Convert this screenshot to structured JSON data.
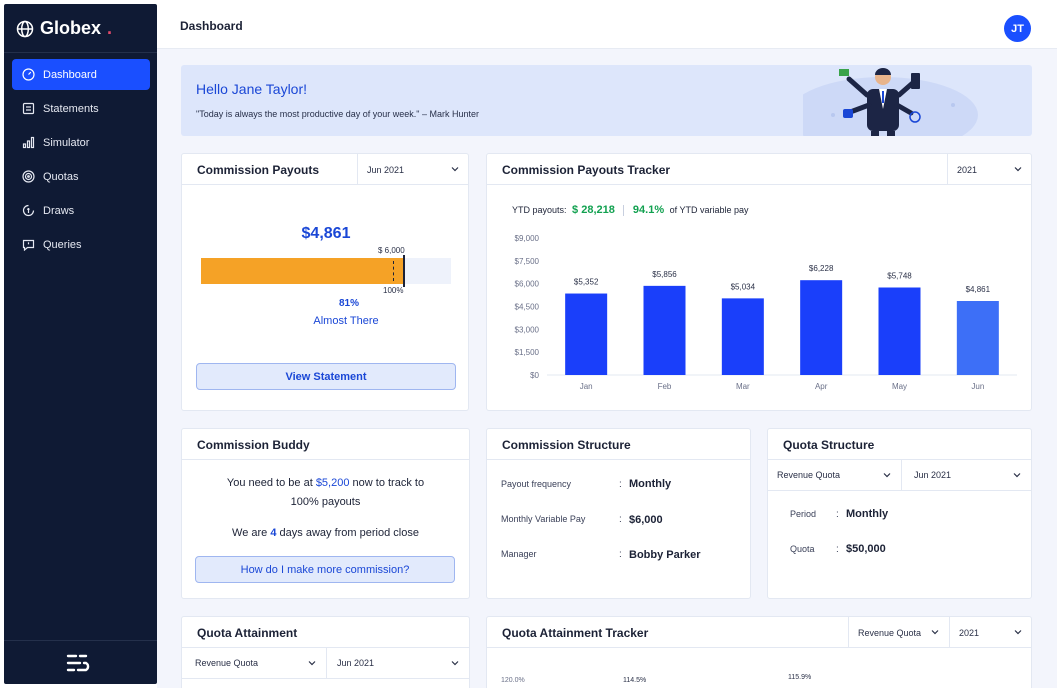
{
  "app": {
    "name": "Globex",
    "dot": "."
  },
  "sidebar": {
    "items": [
      {
        "label": "Dashboard",
        "icon": "dashboard-icon",
        "active": true
      },
      {
        "label": "Statements",
        "icon": "statements-icon"
      },
      {
        "label": "Simulator",
        "icon": "simulator-icon"
      },
      {
        "label": "Quotas",
        "icon": "target-icon"
      },
      {
        "label": "Draws",
        "icon": "draws-icon"
      },
      {
        "label": "Queries",
        "icon": "chat-icon"
      }
    ]
  },
  "header": {
    "title": "Dashboard",
    "avatar_initials": "JT"
  },
  "hero": {
    "greeting": "Hello Jane Taylor!",
    "quote": "\"Today is always the most productive day of your week.\" – Mark Hunter"
  },
  "commission_payouts": {
    "title": "Commission Payouts",
    "period": "Jun 2021",
    "amount": "$4,861",
    "target": "$ 6,000",
    "target_pct": "100%",
    "progress_pct": "81%",
    "progress_fraction": 0.81,
    "status": "Almost There",
    "button": "View Statement"
  },
  "payouts_tracker": {
    "title": "Commission Payouts Tracker",
    "year": "2021",
    "ytd_label": "YTD payouts:",
    "ytd_value": "$ 28,218",
    "variable_pct": "94.1%",
    "variable_label": "of YTD variable pay"
  },
  "chart_data": {
    "type": "bar",
    "categories": [
      "Jan",
      "Feb",
      "Mar",
      "Apr",
      "May",
      "Jun"
    ],
    "values": [
      5352,
      5856,
      5034,
      6228,
      5748,
      4861
    ],
    "data_labels": [
      "$5,352",
      "$5,856",
      "$5,034",
      "$6,228",
      "$5,748",
      "$4,861"
    ],
    "y_ticks": [
      "$0",
      "$1,500",
      "$3,000",
      "$4,500",
      "$6,000",
      "$7,500",
      "$9,000"
    ],
    "ylim": [
      0,
      9000
    ],
    "colors": [
      "#1a3ffa",
      "#1a3ffa",
      "#1a3ffa",
      "#1a3ffa",
      "#1a3ffa",
      "#3d6ff7"
    ],
    "grid": false
  },
  "commission_buddy": {
    "title": "Commission Buddy",
    "line1_prefix": "You need to be at",
    "line1_amount": "$5,200",
    "line1_suffix": "now to track to",
    "line2": "100% payouts",
    "line3_prefix": "We are",
    "line3_days": "4",
    "line3_suffix": "days away from period close",
    "button": "How do I make more commission?"
  },
  "commission_structure": {
    "title": "Commission Structure",
    "rows": [
      {
        "label": "Payout frequency",
        "value": "Monthly"
      },
      {
        "label": "Monthly Variable Pay",
        "value": "$6,000"
      },
      {
        "label": "Manager",
        "value": "Bobby Parker"
      }
    ]
  },
  "quota_structure": {
    "title": "Quota Structure",
    "quota_type": "Revenue Quota",
    "period": "Jun 2021",
    "rows": [
      {
        "label": "Period",
        "value": "Monthly"
      },
      {
        "label": "Quota",
        "value": "$50,000"
      }
    ]
  },
  "quota_attainment": {
    "title": "Quota Attainment",
    "quota_type": "Revenue Quota",
    "period": "Jun 2021"
  },
  "quota_attainment_tracker": {
    "title": "Quota Attainment Tracker",
    "quota_type": "Revenue Quota",
    "year": "2021",
    "y_tick": "120.0%",
    "labels": [
      "114.5%",
      "115.9%"
    ]
  }
}
